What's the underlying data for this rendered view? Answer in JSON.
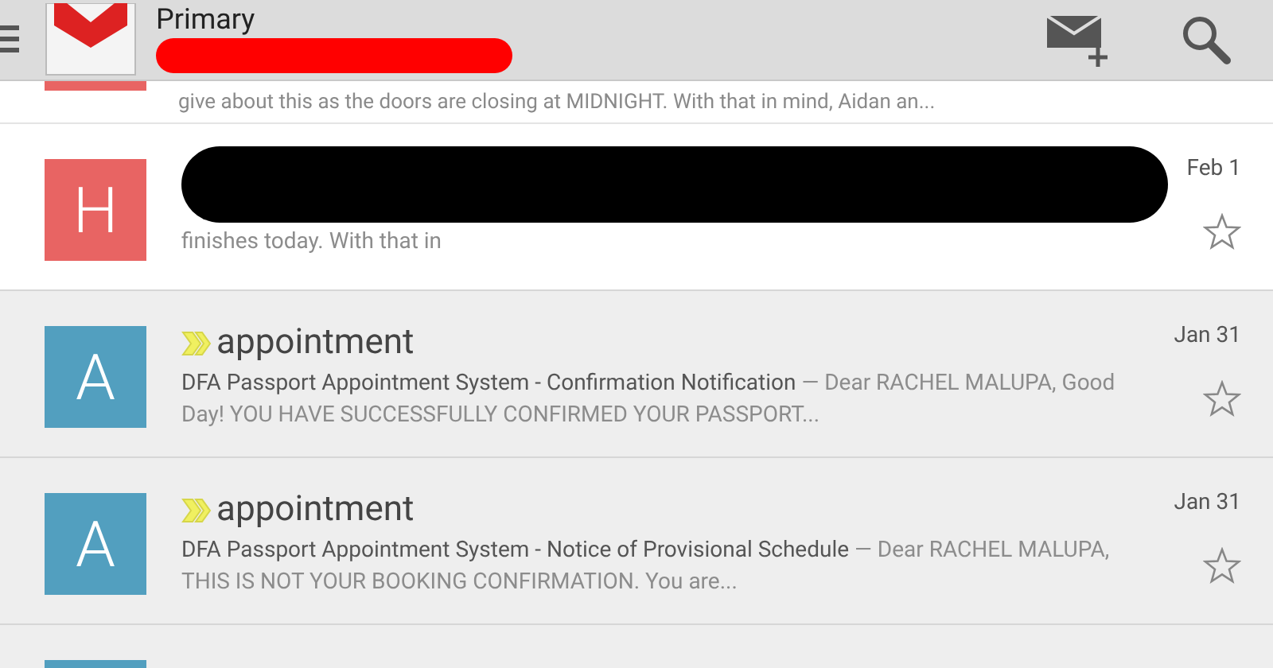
{
  "app_bar": {
    "title": "Primary",
    "account_redacted": true
  },
  "partial_snippet": "give about this as the doors are closing at MIDNIGHT. With that in mind, Aidan an...",
  "messages": [
    {
      "avatar_letter": "H",
      "color": "#e86463",
      "important": false,
      "sender_redacted": true,
      "snippet_rest": "finishes today. With that in",
      "date": "Feb 1",
      "unread": true,
      "starred": false
    },
    {
      "avatar_letter": "A",
      "color": "#529fbf",
      "subject": "appointment",
      "important": true,
      "sender_redacted": false,
      "snippet_first": "DFA Passport Appointment System - Confirmation Notification",
      "snippet_rest": "— Dear RACHEL MALUPA, Good Day! YOU HAVE SUCCESSFULLY CONFIRMED YOUR PASSPORT...",
      "date": "Jan 31",
      "unread": false,
      "starred": false
    },
    {
      "avatar_letter": "A",
      "color": "#529fbf",
      "subject": "appointment",
      "important": true,
      "sender_redacted": false,
      "snippet_first": "DFA Passport Appointment System - Notice of Provisional Schedule",
      "snippet_rest": "— Dear RACHEL MALUPA, THIS IS NOT YOUR BOOKING CONFIRMATION. You are...",
      "date": "Jan 31",
      "unread": false,
      "starred": false
    }
  ],
  "partial_row": {
    "color": "#529fbf"
  }
}
